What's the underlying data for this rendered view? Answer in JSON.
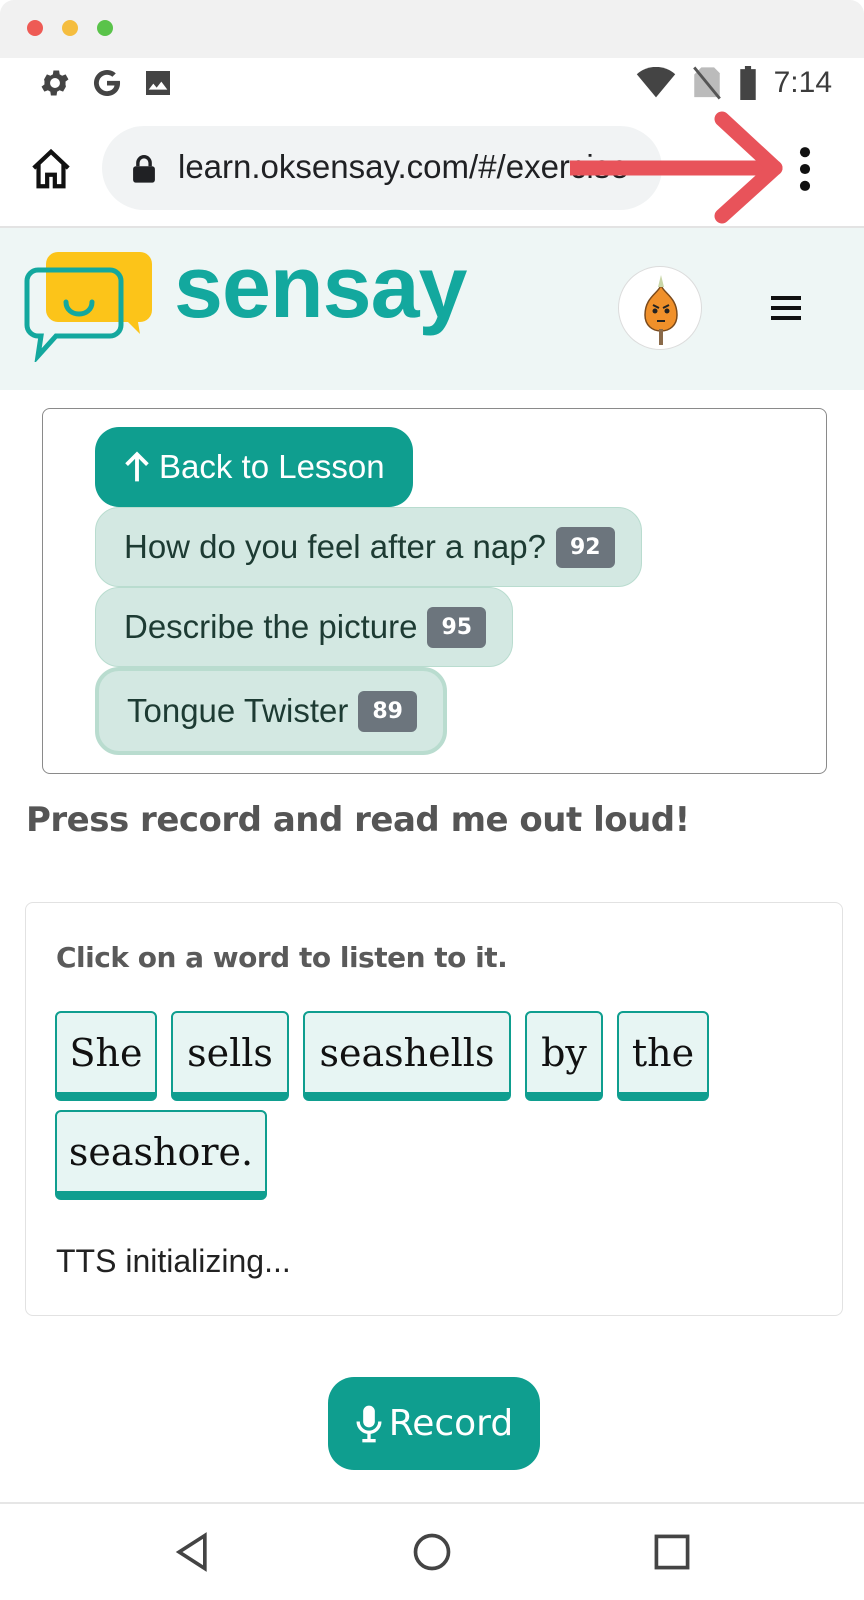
{
  "browser": {
    "url": "learn.oksensay.com/#/exercise",
    "clock": "7:14"
  },
  "header": {
    "brand": "sensay"
  },
  "exercises": {
    "back_label": "Back to Lesson",
    "items": [
      {
        "label": "How do you feel after a nap?",
        "count": "92"
      },
      {
        "label": "Describe the picture",
        "count": "95"
      },
      {
        "label": "Tongue Twister",
        "count": "89"
      }
    ]
  },
  "main": {
    "instruction": "Press record and read me out loud!",
    "card_hint": "Click on a word to listen to it.",
    "words": [
      "She",
      "sells",
      "seashells",
      "by",
      "the",
      "seashore."
    ],
    "tts_status": "TTS initializing...",
    "record_label": "Record"
  },
  "colors": {
    "brand": "#13a89e",
    "button": "#0f9e8f",
    "chip_bg": "#e7f5f3",
    "exercise_bg": "#d3e8e2",
    "badge": "#6c757d",
    "annotation_arrow": "#e8535a"
  }
}
